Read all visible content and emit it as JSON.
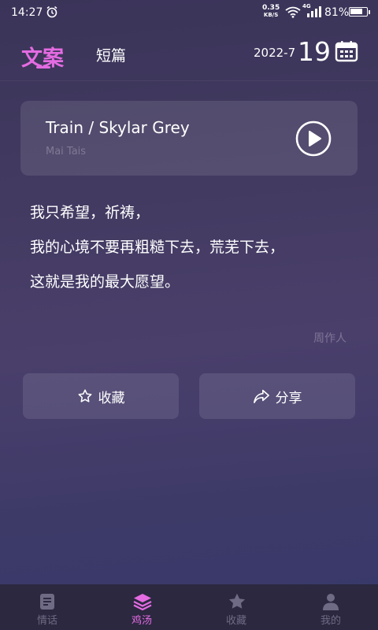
{
  "status_bar": {
    "time": "14:27",
    "net_speed_value": "0.35",
    "net_speed_unit": "KB/S",
    "network": "4G",
    "battery": "81%",
    "battery_level": 0.81
  },
  "header": {
    "tab_main": "文案",
    "tab_short": "短篇",
    "date_year_month": "2022-7",
    "date_day": "19"
  },
  "song": {
    "title": "Train / Skylar Grey",
    "artist": "Mai Tais"
  },
  "quote": {
    "lines": [
      "我只希望，祈祷，",
      "我的心境不要再粗糙下去，荒芜下去，",
      "这就是我的最大愿望。"
    ],
    "author": "周作人"
  },
  "actions": {
    "favorite_label": "收藏",
    "share_label": "分享"
  },
  "bottom_nav": {
    "items": [
      {
        "label": "情话",
        "icon": "book-icon"
      },
      {
        "label": "鸡汤",
        "icon": "layers-icon"
      },
      {
        "label": "收藏",
        "icon": "star-icon"
      },
      {
        "label": "我的",
        "icon": "user-icon"
      }
    ],
    "active_index": 1
  },
  "colors": {
    "accent": "#e46be2",
    "nav_inactive": "#6f6b84",
    "nav_background": "#2b2840"
  }
}
